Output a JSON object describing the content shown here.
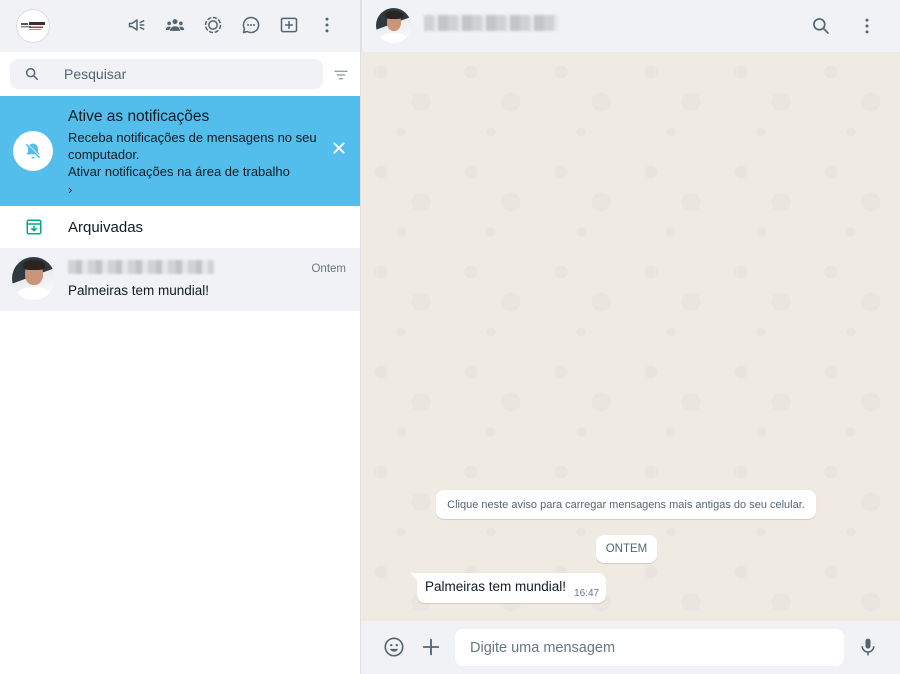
{
  "left_header": {
    "icons": [
      "megaphone-icon",
      "community-icon",
      "status-icon",
      "channels-icon",
      "new-chat-icon",
      "menu-icon"
    ]
  },
  "search": {
    "placeholder": "Pesquisar"
  },
  "notification_banner": {
    "title": "Ative as notificações",
    "text": "Receba notificações de mensagens no seu computador.",
    "link": "Ativar notificações na área de trabalho",
    "arrow": "›"
  },
  "archived": {
    "label": "Arquivadas"
  },
  "chats": [
    {
      "time": "Ontem",
      "preview": "Palmeiras tem mundial!"
    }
  ],
  "conversation": {
    "system_notice": "Clique neste aviso para carregar mensagens mais antigas do seu celular.",
    "date_chip": "ONTEM",
    "messages": [
      {
        "text": "Palmeiras tem mundial!",
        "time": "16:47",
        "direction": "incoming"
      }
    ]
  },
  "composer": {
    "placeholder": "Digite uma mensagem"
  },
  "colors": {
    "banner": "#53bdeb",
    "accent": "#00a884",
    "header_bg": "#f0f2f5",
    "wallpaper": "#efeae2"
  }
}
